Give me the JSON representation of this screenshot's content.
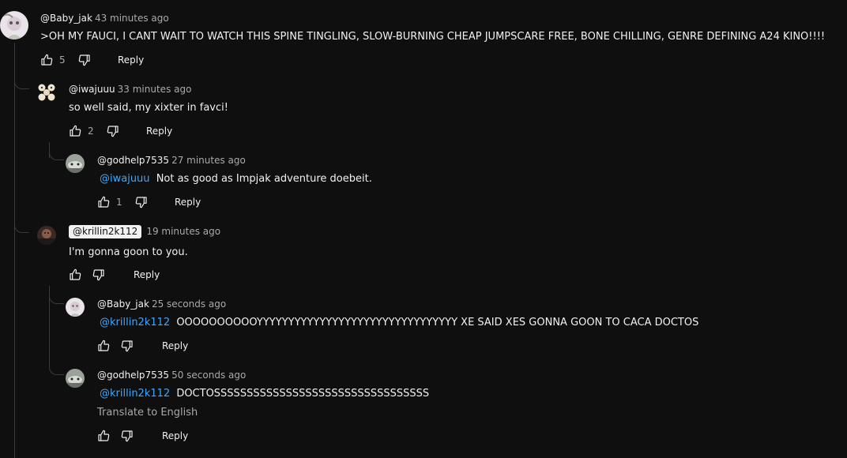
{
  "colors": {
    "background": "#0f0f0f",
    "text": "#f1f1f1",
    "muted": "#aaaaaa",
    "mention": "#3ea6ff",
    "line": "#3a3a3a"
  },
  "icons": {
    "like": "thumbs-up-icon",
    "dislike": "thumbs-down-icon"
  },
  "comments": [
    {
      "author": "@Baby_jak",
      "time": "43 minutes ago",
      "text": ">OH MY FAUCI, I CANT WAIT TO WATCH THIS SPINE TINGLING, SLOW-BURNING CHEAP JUMPSCARE FREE, BONE CHILLING, GENRE DEFINING A24 KINO!!!!",
      "likes": "5",
      "reply_label": "Reply"
    },
    {
      "author": "@iwajuuu",
      "time": "33 minutes ago",
      "text": "so well said, my xixter in favci!",
      "likes": "2",
      "reply_label": "Reply"
    },
    {
      "author": "@godhelp7535",
      "time": "27 minutes ago",
      "mention": "@iwajuuu",
      "text": "Not as good as Impjak adventure doebeit.",
      "likes": "1",
      "reply_label": "Reply"
    },
    {
      "author": "@krillin2k112",
      "time": "19 minutes ago",
      "text": "I'm gonna goon to you.",
      "reply_label": "Reply"
    },
    {
      "author": "@Baby_jak",
      "time": "25 seconds ago",
      "mention": "@krillin2k112",
      "text": "OOOOOOOOOOYYYYYYYYYYYYYYYYYYYYYYYYYYYYYYYY XE SAID XES GONNA GOON TO CACA DOCTOS",
      "reply_label": "Reply"
    },
    {
      "author": "@godhelp7535",
      "time": "50 seconds ago",
      "mention": "@krillin2k112",
      "text": "DOCTOSSSSSSSSSSSSSSSSSSSSSSSSSSSSSSSSS",
      "translate": "Translate to English",
      "reply_label": "Reply"
    }
  ]
}
